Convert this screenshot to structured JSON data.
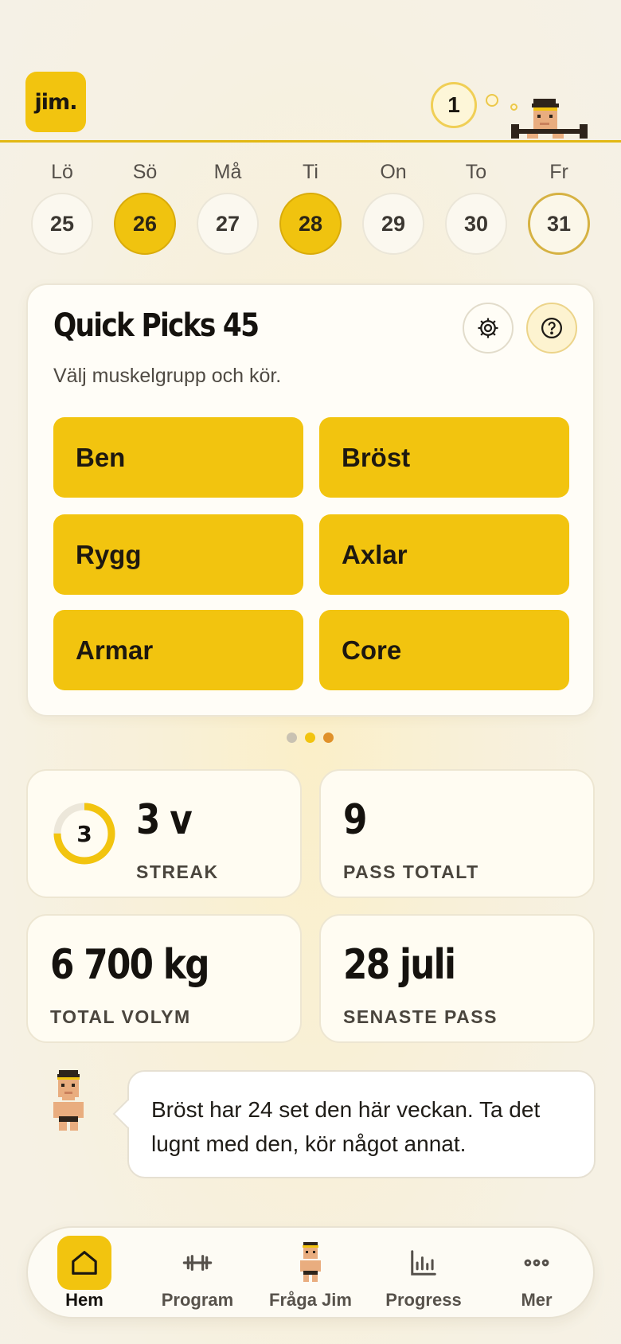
{
  "header": {
    "logo_text": "jim.",
    "level": "1"
  },
  "week": [
    {
      "label": "Lö",
      "date": "25",
      "state": "none"
    },
    {
      "label": "Sö",
      "date": "26",
      "state": "done"
    },
    {
      "label": "Må",
      "date": "27",
      "state": "none"
    },
    {
      "label": "Ti",
      "date": "28",
      "state": "done"
    },
    {
      "label": "On",
      "date": "29",
      "state": "none"
    },
    {
      "label": "To",
      "date": "30",
      "state": "none"
    },
    {
      "label": "Fr",
      "date": "31",
      "state": "today"
    }
  ],
  "quick_picks": {
    "title": "Quick Picks 45",
    "subtitle": "Välj muskelgrupp och kör.",
    "settings_icon": "gear-icon",
    "help_icon": "help-icon",
    "groups": [
      "Ben",
      "Bröst",
      "Rygg",
      "Axlar",
      "Armar",
      "Core"
    ]
  },
  "carousel": {
    "page_count": 3,
    "active_index": 1,
    "colors": [
      "#c9c2b2",
      "#f2c40f",
      "#e0912a"
    ]
  },
  "stats": {
    "streak": {
      "ring_value": "3",
      "value": "3 v",
      "label": "STREAK",
      "ring_fraction": 0.75
    },
    "total_sessions": {
      "value": "9",
      "label": "PASS TOTALT"
    },
    "total_volume": {
      "value": "6 700 kg",
      "label": "TOTAL VOLYM"
    },
    "last_session": {
      "value": "28 juli",
      "label": "SENASTE PASS"
    }
  },
  "tip": {
    "text": "Bröst har 24 set den här veckan. Ta det lugnt med den, kör något annat."
  },
  "nav": {
    "active": "Hem",
    "items": [
      {
        "label": "Hem",
        "icon": "home-icon"
      },
      {
        "label": "Program",
        "icon": "dumbbell-icon"
      },
      {
        "label": "Fråga Jim",
        "icon": "jim-avatar-icon"
      },
      {
        "label": "Progress",
        "icon": "chart-icon"
      },
      {
        "label": "Mer",
        "icon": "more-icon"
      }
    ]
  },
  "colors": {
    "accent": "#f2c40f",
    "accent_dark": "#d9ab0a",
    "text": "#15120e"
  }
}
